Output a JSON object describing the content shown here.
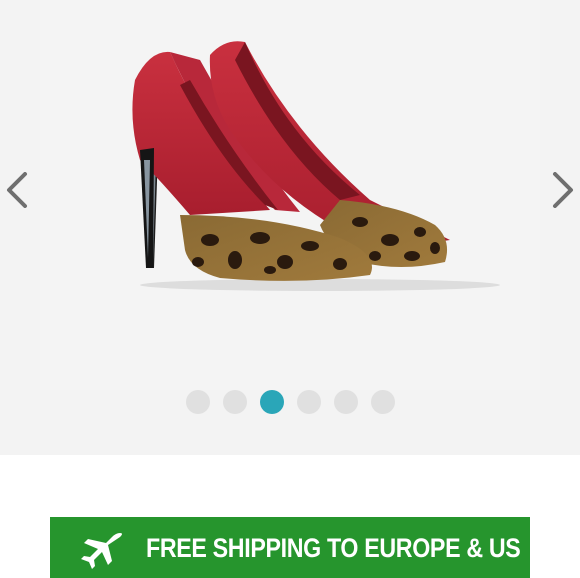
{
  "gallery": {
    "image_alt": "Red suede pointed-toe stiletto pumps with leopard print toe cap",
    "dot_count": 6,
    "active_index": 2,
    "prev_icon": "chevron-left-icon",
    "next_icon": "chevron-right-icon"
  },
  "banner": {
    "icon": "airplane-icon",
    "text": "FREE SHIPPING TO EUROPE & US",
    "background": "#26952d"
  },
  "colors": {
    "dot_active": "#2aa6b8",
    "dot_inactive": "#e0e0e0"
  }
}
